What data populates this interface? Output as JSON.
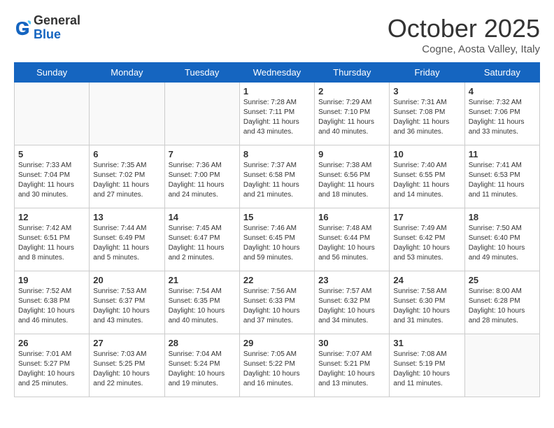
{
  "logo": {
    "line1": "General",
    "line2": "Blue"
  },
  "title": "October 2025",
  "subtitle": "Cogne, Aosta Valley, Italy",
  "weekdays": [
    "Sunday",
    "Monday",
    "Tuesday",
    "Wednesday",
    "Thursday",
    "Friday",
    "Saturday"
  ],
  "weeks": [
    [
      {
        "day": "",
        "info": "",
        "empty": true
      },
      {
        "day": "",
        "info": "",
        "empty": true
      },
      {
        "day": "",
        "info": "",
        "empty": true
      },
      {
        "day": "1",
        "info": "Sunrise: 7:28 AM\nSunset: 7:11 PM\nDaylight: 11 hours\nand 43 minutes."
      },
      {
        "day": "2",
        "info": "Sunrise: 7:29 AM\nSunset: 7:10 PM\nDaylight: 11 hours\nand 40 minutes."
      },
      {
        "day": "3",
        "info": "Sunrise: 7:31 AM\nSunset: 7:08 PM\nDaylight: 11 hours\nand 36 minutes."
      },
      {
        "day": "4",
        "info": "Sunrise: 7:32 AM\nSunset: 7:06 PM\nDaylight: 11 hours\nand 33 minutes."
      }
    ],
    [
      {
        "day": "5",
        "info": "Sunrise: 7:33 AM\nSunset: 7:04 PM\nDaylight: 11 hours\nand 30 minutes."
      },
      {
        "day": "6",
        "info": "Sunrise: 7:35 AM\nSunset: 7:02 PM\nDaylight: 11 hours\nand 27 minutes."
      },
      {
        "day": "7",
        "info": "Sunrise: 7:36 AM\nSunset: 7:00 PM\nDaylight: 11 hours\nand 24 minutes."
      },
      {
        "day": "8",
        "info": "Sunrise: 7:37 AM\nSunset: 6:58 PM\nDaylight: 11 hours\nand 21 minutes."
      },
      {
        "day": "9",
        "info": "Sunrise: 7:38 AM\nSunset: 6:56 PM\nDaylight: 11 hours\nand 18 minutes."
      },
      {
        "day": "10",
        "info": "Sunrise: 7:40 AM\nSunset: 6:55 PM\nDaylight: 11 hours\nand 14 minutes."
      },
      {
        "day": "11",
        "info": "Sunrise: 7:41 AM\nSunset: 6:53 PM\nDaylight: 11 hours\nand 11 minutes."
      }
    ],
    [
      {
        "day": "12",
        "info": "Sunrise: 7:42 AM\nSunset: 6:51 PM\nDaylight: 11 hours\nand 8 minutes."
      },
      {
        "day": "13",
        "info": "Sunrise: 7:44 AM\nSunset: 6:49 PM\nDaylight: 11 hours\nand 5 minutes."
      },
      {
        "day": "14",
        "info": "Sunrise: 7:45 AM\nSunset: 6:47 PM\nDaylight: 11 hours\nand 2 minutes."
      },
      {
        "day": "15",
        "info": "Sunrise: 7:46 AM\nSunset: 6:45 PM\nDaylight: 10 hours\nand 59 minutes."
      },
      {
        "day": "16",
        "info": "Sunrise: 7:48 AM\nSunset: 6:44 PM\nDaylight: 10 hours\nand 56 minutes."
      },
      {
        "day": "17",
        "info": "Sunrise: 7:49 AM\nSunset: 6:42 PM\nDaylight: 10 hours\nand 53 minutes."
      },
      {
        "day": "18",
        "info": "Sunrise: 7:50 AM\nSunset: 6:40 PM\nDaylight: 10 hours\nand 49 minutes."
      }
    ],
    [
      {
        "day": "19",
        "info": "Sunrise: 7:52 AM\nSunset: 6:38 PM\nDaylight: 10 hours\nand 46 minutes."
      },
      {
        "day": "20",
        "info": "Sunrise: 7:53 AM\nSunset: 6:37 PM\nDaylight: 10 hours\nand 43 minutes."
      },
      {
        "day": "21",
        "info": "Sunrise: 7:54 AM\nSunset: 6:35 PM\nDaylight: 10 hours\nand 40 minutes."
      },
      {
        "day": "22",
        "info": "Sunrise: 7:56 AM\nSunset: 6:33 PM\nDaylight: 10 hours\nand 37 minutes."
      },
      {
        "day": "23",
        "info": "Sunrise: 7:57 AM\nSunset: 6:32 PM\nDaylight: 10 hours\nand 34 minutes."
      },
      {
        "day": "24",
        "info": "Sunrise: 7:58 AM\nSunset: 6:30 PM\nDaylight: 10 hours\nand 31 minutes."
      },
      {
        "day": "25",
        "info": "Sunrise: 8:00 AM\nSunset: 6:28 PM\nDaylight: 10 hours\nand 28 minutes."
      }
    ],
    [
      {
        "day": "26",
        "info": "Sunrise: 7:01 AM\nSunset: 5:27 PM\nDaylight: 10 hours\nand 25 minutes."
      },
      {
        "day": "27",
        "info": "Sunrise: 7:03 AM\nSunset: 5:25 PM\nDaylight: 10 hours\nand 22 minutes."
      },
      {
        "day": "28",
        "info": "Sunrise: 7:04 AM\nSunset: 5:24 PM\nDaylight: 10 hours\nand 19 minutes."
      },
      {
        "day": "29",
        "info": "Sunrise: 7:05 AM\nSunset: 5:22 PM\nDaylight: 10 hours\nand 16 minutes."
      },
      {
        "day": "30",
        "info": "Sunrise: 7:07 AM\nSunset: 5:21 PM\nDaylight: 10 hours\nand 13 minutes."
      },
      {
        "day": "31",
        "info": "Sunrise: 7:08 AM\nSunset: 5:19 PM\nDaylight: 10 hours\nand 11 minutes."
      },
      {
        "day": "",
        "info": "",
        "empty": true
      }
    ]
  ]
}
